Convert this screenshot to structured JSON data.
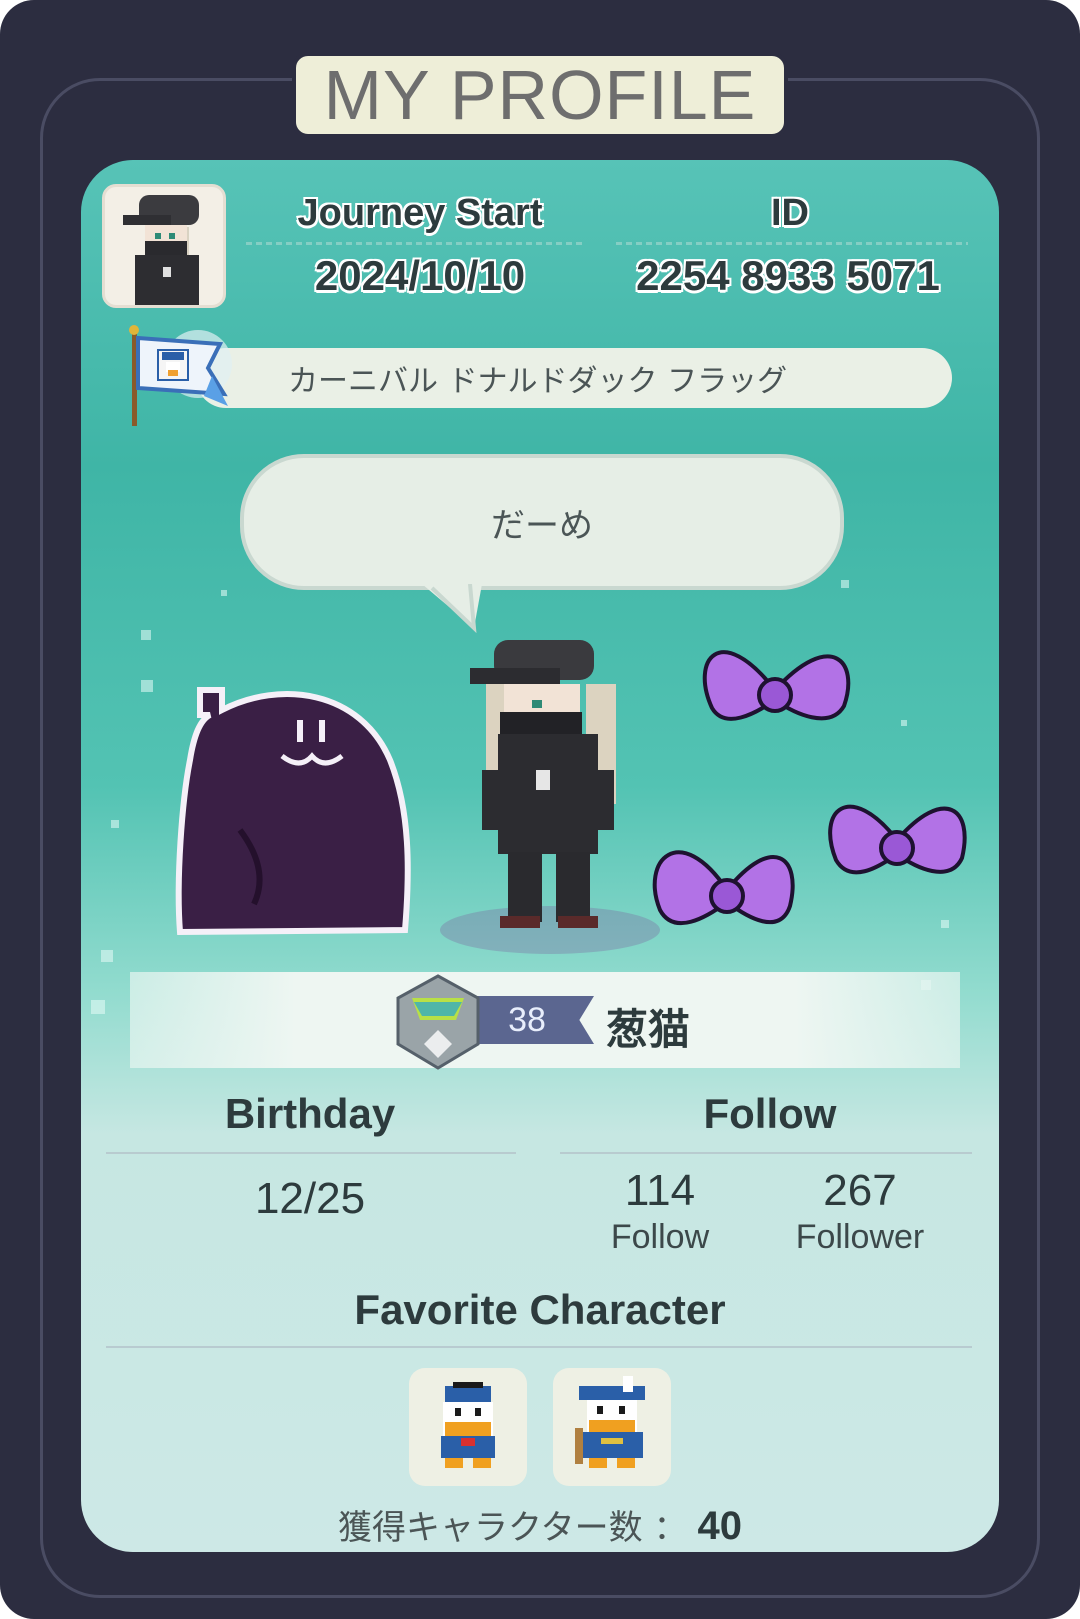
{
  "header": {
    "title": "MY PROFILE"
  },
  "profile": {
    "journey_label": "Journey Start",
    "journey_date": "2024/10/10",
    "id_label": "ID",
    "id_value": "2254 8933 5071",
    "flag_name": "カーニバル ドナルドダック フラッグ",
    "speech": "だーめ",
    "level": "38",
    "player_name": "葱猫"
  },
  "stats": {
    "birthday_label": "Birthday",
    "birthday_value": "12/25",
    "follow_label": "Follow",
    "follow_count": "114",
    "follow_sub": "Follow",
    "follower_count": "267",
    "follower_sub": "Follower"
  },
  "favorites": {
    "label": "Favorite Character",
    "characters": [
      "donald-duck-icon",
      "donald-duck-musketeer-icon"
    ],
    "count_label": "獲得キャラクター数 ：",
    "count_value": "40"
  },
  "colors": {
    "frame": "#2c2d40",
    "card_top": "#3fb5a6",
    "card_bottom": "#cde8e6",
    "bow": "#b272e6",
    "ghost": "#3a1f45",
    "level_tag": "#5b6690"
  }
}
